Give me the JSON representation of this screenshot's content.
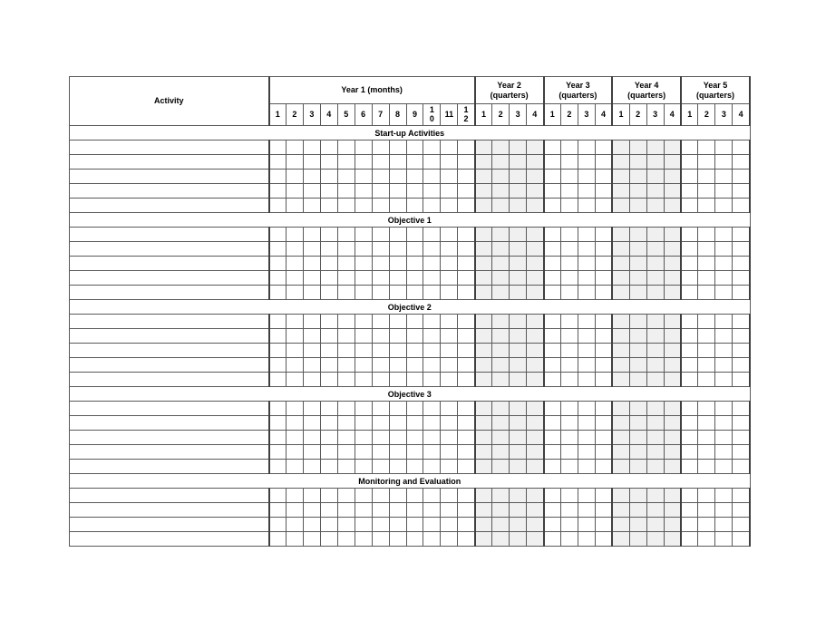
{
  "table": {
    "activity_header": "Activity",
    "column_groups": [
      {
        "id": "year1",
        "label": "Year 1 (months)",
        "unit": "months",
        "shaded": false,
        "columns": [
          "1",
          "2",
          "3",
          "4",
          "5",
          "6",
          "7",
          "8",
          "9",
          "10",
          "11",
          "12"
        ]
      },
      {
        "id": "year2",
        "label": "Year 2 (quarters)",
        "label_line1": "Year 2",
        "label_line2": "(quarters)",
        "unit": "quarters",
        "shaded": true,
        "columns": [
          "1",
          "2",
          "3",
          "4"
        ]
      },
      {
        "id": "year3",
        "label": "Year 3 (quarters)",
        "label_line1": "Year 3",
        "label_line2": "(quarters)",
        "unit": "quarters",
        "shaded": false,
        "columns": [
          "1",
          "2",
          "3",
          "4"
        ]
      },
      {
        "id": "year4",
        "label": "Year 4 (quarters)",
        "label_line1": "Year 4",
        "label_line2": "(quarters)",
        "unit": "quarters",
        "shaded": true,
        "columns": [
          "1",
          "2",
          "3",
          "4"
        ]
      },
      {
        "id": "year5",
        "label": "Year 5 (quarters)",
        "label_line1": "Year 5",
        "label_line2": "(quarters)",
        "unit": "quarters",
        "shaded": false,
        "columns": [
          "1",
          "2",
          "3",
          "4"
        ]
      }
    ],
    "sections": [
      {
        "id": "start-up-activities",
        "title": "Start-up Activities",
        "row_count": 5
      },
      {
        "id": "objective-1",
        "title": "Objective 1",
        "row_count": 5
      },
      {
        "id": "objective-2",
        "title": "Objective 2",
        "row_count": 5
      },
      {
        "id": "objective-3",
        "title": "Objective 3",
        "row_count": 5
      },
      {
        "id": "monitoring-and-evaluation",
        "title": "Monitoring and Evaluation",
        "row_count": 4
      }
    ]
  },
  "colors": {
    "header_fill": "#d9d9d9",
    "shaded_cell_fill": "#f0f0f0",
    "grid_line": "#595959",
    "group_separator": "#404040",
    "page_background": "#ffffff",
    "text": "#000000"
  }
}
